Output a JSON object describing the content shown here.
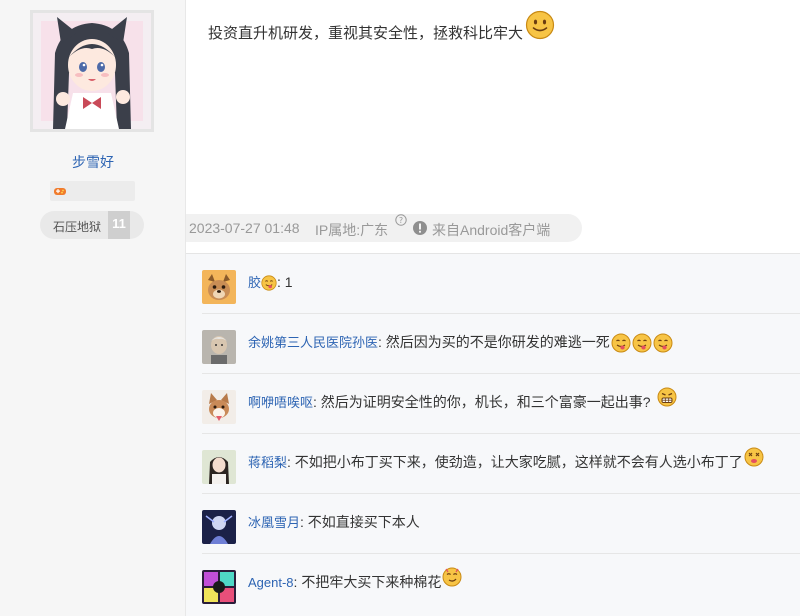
{
  "author": {
    "name": "步雪好",
    "level_name": "石压地狱",
    "level_num": "11"
  },
  "post": {
    "text": "投资直升机研发，重视其安全性，拯救科比牢大",
    "time": "2023-07-27 01:48",
    "ip_location": "IP属地:广东",
    "client": "来自Android客户端"
  },
  "comments": [
    {
      "user": "胶",
      "sep": ": ",
      "text": "1",
      "emojis": []
    },
    {
      "user": "余姚第三人民医院孙医",
      "sep": ": ",
      "text": "然后因为买的不是你研发的难逃一死",
      "emojis": [
        "tongue-emoji",
        "tongue-emoji",
        "tongue-emoji"
      ]
    },
    {
      "user": "啊咿唔唉呕",
      "sep": ": ",
      "text": "然后为证明安全性的你，机长，和三个富豪一起出事?",
      "emojis": [
        "grimace-emoji"
      ]
    },
    {
      "user": "蒋稻梨",
      "sep": ": ",
      "text": "不如把小布丁买下来，使劲造，让大家吃腻，这样就不会有人选小布丁了",
      "emojis": [
        "dizzy-emoji"
      ]
    },
    {
      "user": "冰凰雪月",
      "sep": ": ",
      "text": "不如直接买下本人",
      "emojis": []
    },
    {
      "user": "Agent-8",
      "sep": ": ",
      "text": "不把牢大买下来种棉花",
      "emojis": [
        "smirk-emoji"
      ]
    }
  ],
  "colors": {
    "link": "#2d64b3",
    "meta_gray": "#999999",
    "comment_bg": "#f7f8fa"
  }
}
